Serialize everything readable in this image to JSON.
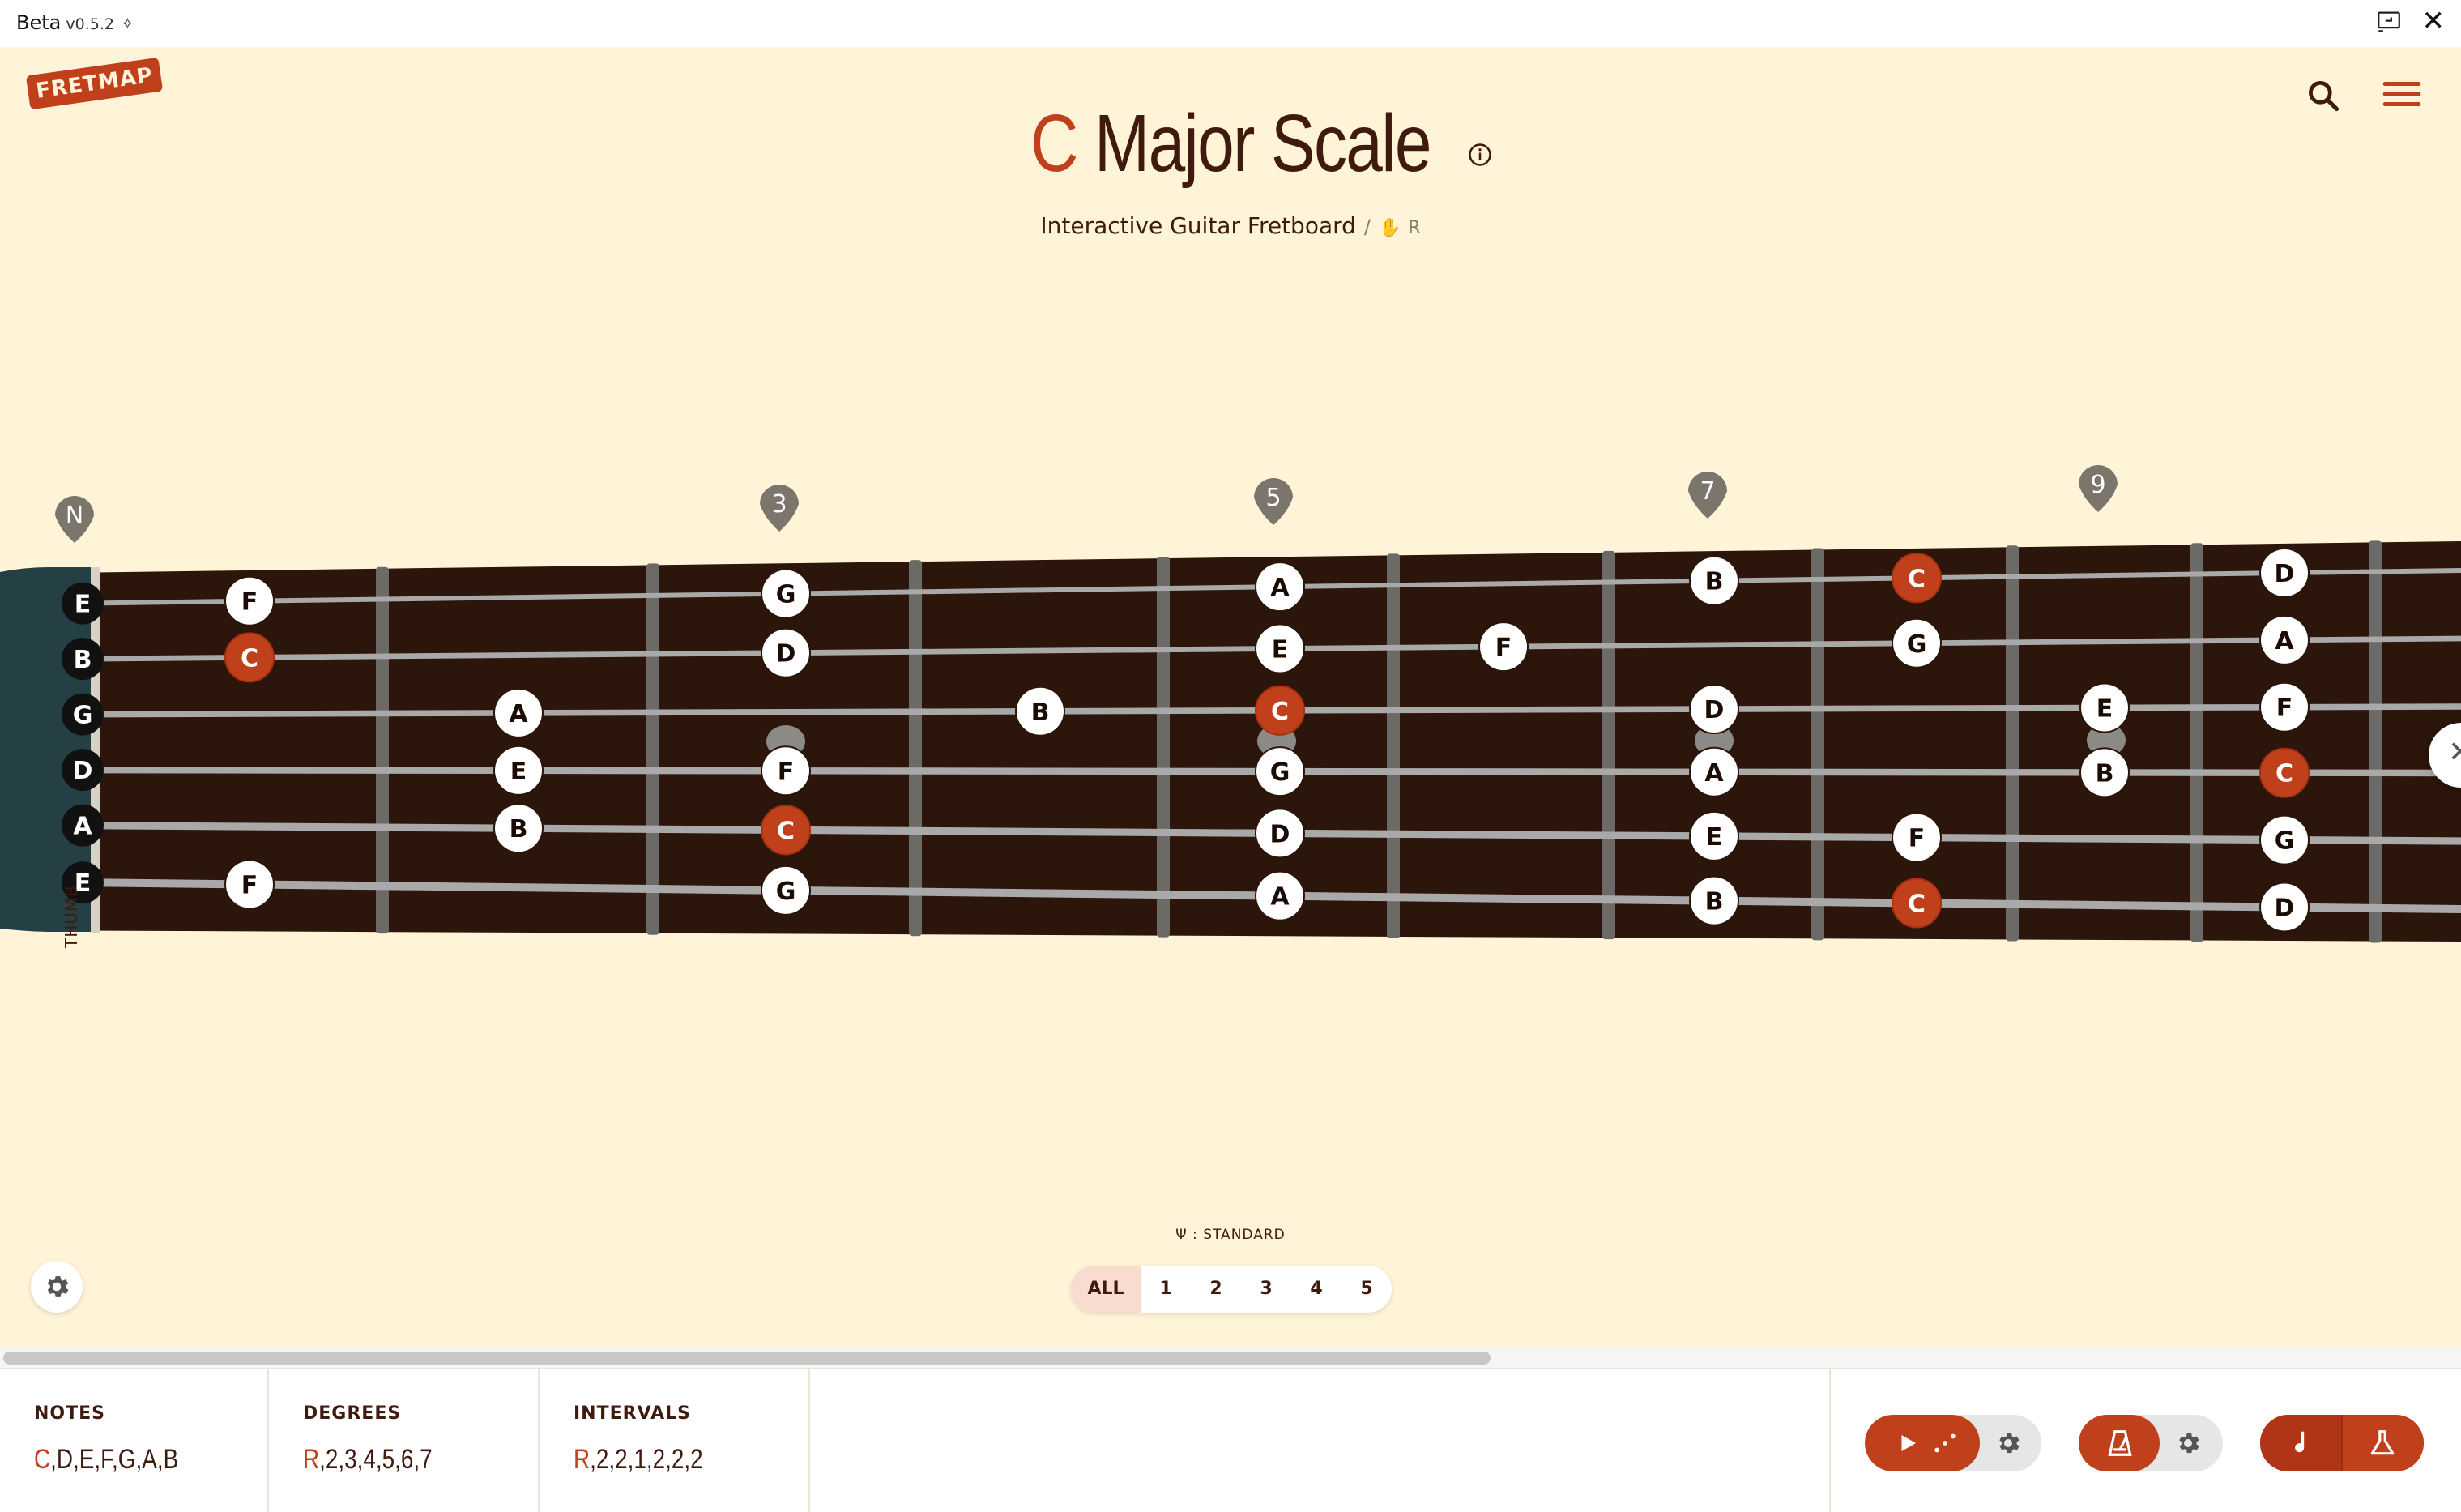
{
  "titlebar": {
    "app_name": "Beta",
    "version": "v0.5.2"
  },
  "logo": {
    "text": "FRETMAP"
  },
  "header": {
    "root_note": "C",
    "scale_name": "Major Scale",
    "subtitle": "Interactive Guitar Fretboard",
    "separator": "/",
    "hand_label": "R"
  },
  "colors": {
    "accent": "#c1401c",
    "text_dark": "#3f1a0e",
    "background": "#fff4d8",
    "fretboard": "#2c150a",
    "nut": "#244044",
    "marker": "#7b756c"
  },
  "fret_markers": [
    "N",
    "3",
    "5",
    "7",
    "9"
  ],
  "open_strings": [
    "E",
    "B",
    "G",
    "D",
    "A",
    "E"
  ],
  "fretboard_notes": {
    "string_1": [
      [
        "F",
        1
      ],
      [
        "G",
        3
      ],
      [
        "A",
        5
      ],
      [
        "B",
        7
      ],
      [
        "C",
        8
      ],
      [
        "D",
        10
      ]
    ],
    "string_2": [
      [
        "C",
        1
      ],
      [
        "D",
        3
      ],
      [
        "E",
        5
      ],
      [
        "F",
        6
      ],
      [
        "G",
        8
      ],
      [
        "A",
        10
      ]
    ],
    "string_3": [
      [
        "A",
        2
      ],
      [
        "B",
        4
      ],
      [
        "C",
        5
      ],
      [
        "D",
        7
      ],
      [
        "E",
        9
      ],
      [
        "F",
        10
      ]
    ],
    "string_4": [
      [
        "E",
        2
      ],
      [
        "F",
        3
      ],
      [
        "G",
        5
      ],
      [
        "A",
        7
      ],
      [
        "B",
        9
      ],
      [
        "C",
        10
      ]
    ],
    "string_5": [
      [
        "B",
        2
      ],
      [
        "C",
        3
      ],
      [
        "D",
        5
      ],
      [
        "E",
        7
      ],
      [
        "F",
        8
      ],
      [
        "G",
        10
      ]
    ],
    "string_6": [
      [
        "F",
        1
      ],
      [
        "G",
        3
      ],
      [
        "A",
        5
      ],
      [
        "B",
        7
      ],
      [
        "C",
        8
      ],
      [
        "D",
        10
      ]
    ]
  },
  "thumb_label": "THUMB",
  "tuning": {
    "label": "STANDARD",
    "icon": "tuning-fork-icon"
  },
  "positions": [
    "ALL",
    "1",
    "2",
    "3",
    "4",
    "5"
  ],
  "active_position": "ALL",
  "info": {
    "notes_label": "NOTES",
    "notes_root": "C",
    "notes_rest": ",D,E,F,G,A,B",
    "degrees_label": "DEGREES",
    "degrees_root": "R",
    "degrees_rest": ",2,3,4,5,6,7",
    "intervals_label": "INTERVALS",
    "intervals_root": "R",
    "intervals_rest": ",2,2,1,2,2,2"
  },
  "icons": {
    "search": "search-icon",
    "menu": "hamburger-menu-icon",
    "info": "info-icon",
    "settings": "gear-icon",
    "play": "play-icon",
    "metronome": "metronome-icon",
    "note": "music-note-icon",
    "lab": "flask-icon"
  }
}
